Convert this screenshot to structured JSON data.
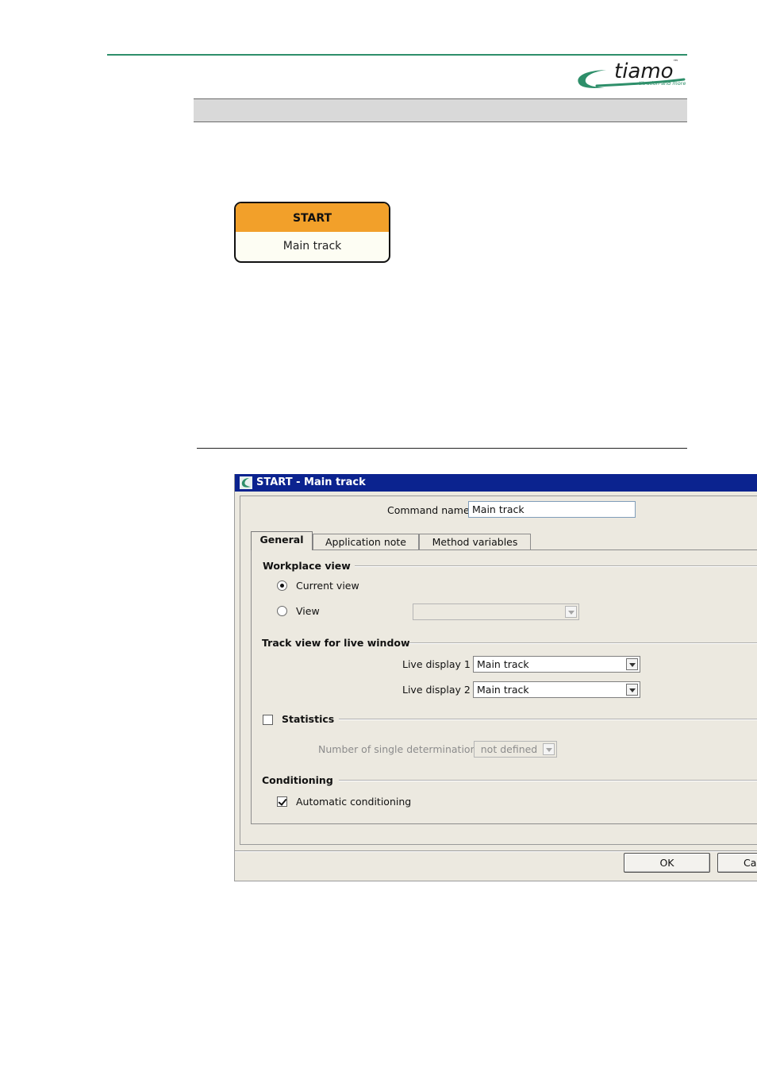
{
  "header": {
    "logo_text": "tiamo",
    "logo_trademark": "™",
    "logo_tagline": "titration and more",
    "brand_color": "#2e8f6a"
  },
  "start_node": {
    "title": "START",
    "label": "Main track",
    "header_color": "#f2a02a"
  },
  "dialog": {
    "title": "START - Main track",
    "icon": "tiamo-app-icon",
    "command_name_label": "Command name",
    "command_name_value": "Main track",
    "tabs": [
      {
        "label": "General",
        "active": true
      },
      {
        "label": "Application note",
        "active": false
      },
      {
        "label": "Method variables",
        "active": false
      }
    ],
    "workplace_view": {
      "heading": "Workplace view",
      "current_view_label": "Current view",
      "current_view_selected": true,
      "view_label": "View",
      "view_selected": false,
      "view_combo_value": ""
    },
    "track_view": {
      "heading": "Track view for live window",
      "live_display_1_label": "Live display 1",
      "live_display_1_value": "Main track",
      "live_display_2_label": "Live display 2",
      "live_display_2_value": "Main track"
    },
    "statistics": {
      "label": "Statistics",
      "checked": false,
      "single_determinations_label": "Number of single determinations",
      "single_determinations_value": "not defined"
    },
    "conditioning": {
      "heading": "Conditioning",
      "automatic_label": "Automatic conditioning",
      "automatic_checked": true
    },
    "buttons": {
      "ok": "OK",
      "cancel": "Cancel"
    },
    "titlebar_color": "#0b238f"
  }
}
